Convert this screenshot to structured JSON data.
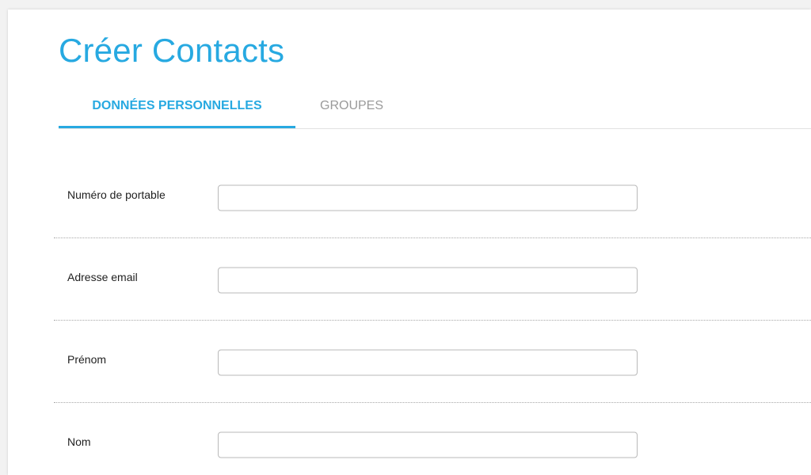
{
  "page": {
    "title": "Créer Contacts"
  },
  "colors": {
    "accent": "#27a9e1",
    "inactive_tab": "#9a9a9a",
    "label": "#1f1f1f"
  },
  "tabs": [
    {
      "label": "DONNÉES PERSONNELLES",
      "active": true
    },
    {
      "label": "GROUPES",
      "active": false
    }
  ],
  "form": {
    "fields": [
      {
        "label": "Numéro de portable",
        "value": "",
        "placeholder": ""
      },
      {
        "label": "Adresse email",
        "value": "",
        "placeholder": ""
      },
      {
        "label": "Prénom",
        "value": "",
        "placeholder": ""
      },
      {
        "label": "Nom",
        "value": "",
        "placeholder": ""
      }
    ]
  }
}
